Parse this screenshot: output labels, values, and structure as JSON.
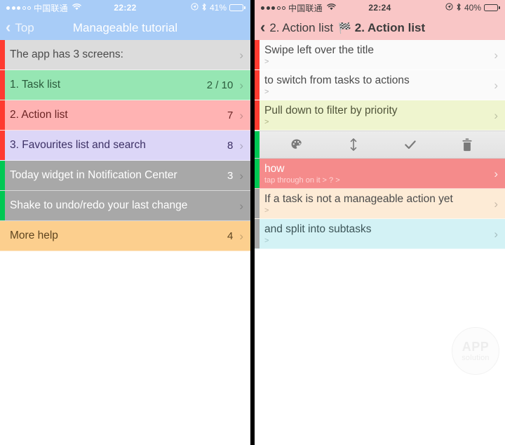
{
  "left": {
    "theme": {
      "status_bg": "#a8ccf7",
      "nav_bg": "#a8ccf7",
      "status_fg": "#ffffff",
      "nav_fg": "#ffffff"
    },
    "status": {
      "carrier": "中国联通",
      "signal_filled": 3,
      "signal_total": 5,
      "wifi_icon": "wifi-icon",
      "time": "22:22",
      "location_icon": "location-arrow-icon",
      "bluetooth_icon": "bluetooth-icon",
      "battery_text": "41%",
      "battery_level": 41
    },
    "nav": {
      "back_icon": "chevron-left-icon",
      "back_label": "Top",
      "title": "Manageable tutorial"
    },
    "rows": [
      {
        "title": "The app has 3 screens:",
        "value": "",
        "bg": "#dcdcdc",
        "fg": "#4b4b4b",
        "stripe": "#ff3b30",
        "chevron": "›"
      },
      {
        "title": "1. Task list",
        "value": "2 / 10",
        "bg": "#96e6b3",
        "fg": "#2b5b3c",
        "stripe": "#ff3b30",
        "chevron": "›"
      },
      {
        "title": "2. Action list",
        "value": "7",
        "bg": "#ffb3b3",
        "fg": "#6b2525",
        "stripe": "#ff3b30",
        "chevron": "›"
      },
      {
        "title": "3. Favourites list and search",
        "value": "8",
        "bg": "#dcd6f7",
        "fg": "#3d3166",
        "stripe": "#ff3b30",
        "chevron": "›"
      },
      {
        "title": "Today widget in Notification Center",
        "value": "3",
        "bg": "#a8a8a8",
        "fg": "#ffffff",
        "stripe": "#00c853",
        "chevron": "›"
      },
      {
        "title": "Shake to undo/redo your last change",
        "value": "",
        "bg": "#a8a8a8",
        "fg": "#ffffff",
        "stripe": "#00c853",
        "chevron": "›"
      },
      {
        "title": "More help",
        "value": "4",
        "bg": "#fccf8e",
        "fg": "#5e4520",
        "stripe": "#fccf8e",
        "chevron": "›"
      }
    ]
  },
  "right": {
    "theme": {
      "status_bg": "#f9c6c6",
      "nav_bg": "#f9c6c6",
      "status_fg": "#3c3c3c",
      "nav_fg": "#3c3c3c"
    },
    "status": {
      "carrier": "中国联通",
      "signal_filled": 3,
      "signal_total": 5,
      "wifi_icon": "wifi-icon",
      "time": "22:24",
      "location_icon": "location-arrow-icon",
      "bluetooth_icon": "bluetooth-icon",
      "battery_text": "40%",
      "battery_level": 40
    },
    "nav": {
      "back_icon": "chevron-left-icon",
      "back_label": "2. Action list",
      "flag_icon": "checkered-flag-icon",
      "title": "2. Action list"
    },
    "rows_top": [
      {
        "title": "Swipe left over the title",
        "subtitle": ">",
        "bg": "#fafafa",
        "fg": "#4b4b4b",
        "sub_fg": "#b3b3b3",
        "stripe": "#ff3b30",
        "chevron": "›"
      },
      {
        "title": "to switch from tasks to actions",
        "subtitle": ">",
        "bg": "#fafafa",
        "fg": "#4b4b4b",
        "sub_fg": "#b3b3b3",
        "stripe": "#ff3b30",
        "chevron": "›"
      },
      {
        "title": "Pull down to filter by priority",
        "subtitle": ">",
        "bg": "#eff5cf",
        "fg": "#50543a",
        "sub_fg": "#aab07f",
        "stripe": "#ff3b30",
        "chevron": "›"
      }
    ],
    "toolbar": {
      "stripe": "#00c853",
      "buttons": [
        {
          "icon": "palette-icon",
          "label": "Colour"
        },
        {
          "icon": "reorder-arrows-icon",
          "label": "Reorder"
        },
        {
          "icon": "check-icon",
          "label": "Complete"
        },
        {
          "icon": "trash-icon",
          "label": "Delete"
        }
      ]
    },
    "rows_bottom": [
      {
        "title": "how",
        "subtitle": "tap through on it > ?   >",
        "bg": "#f58b8b",
        "fg": "#ffffff",
        "sub_fg": "#ffd4d4",
        "stripe": "#00c853",
        "chevron": "›",
        "selected": true
      },
      {
        "title": "If a task is not a manageable action yet",
        "subtitle": ">",
        "bg": "#fdebd6",
        "fg": "#4b4b4b",
        "sub_fg": "#c7b69f",
        "stripe": "#a8a8a8",
        "chevron": "›"
      },
      {
        "title": "and split into subtasks",
        "subtitle": ">",
        "bg": "#d3f2f5",
        "fg": "#3c5457",
        "sub_fg": "#9fc3c7",
        "stripe": "#a8a8a8",
        "chevron": "›"
      }
    ],
    "watermark": {
      "top": "APP",
      "bottom": "solution"
    }
  }
}
